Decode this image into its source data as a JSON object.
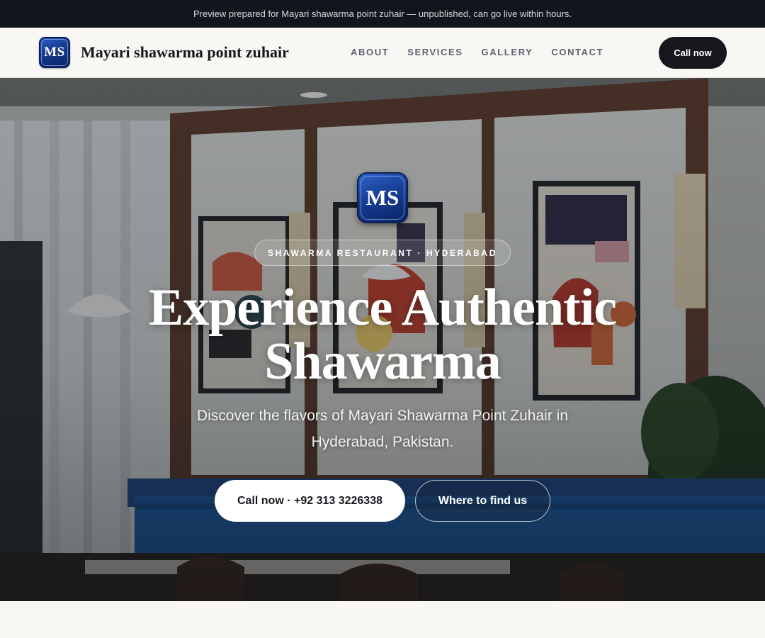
{
  "preview_banner": {
    "text": "Preview prepared for Mayari shawarma point zuhair — unpublished, can go live within hours."
  },
  "header": {
    "logo_initials": "MS",
    "brand_name": "Mayari shawarma point zuhair",
    "nav": [
      "ABOUT",
      "SERVICES",
      "GALLERY",
      "CONTACT"
    ],
    "cta_label": "Call now"
  },
  "hero": {
    "logo_initials": "MS",
    "eyebrow": "SHAWARMA RESTAURANT · HYDERABAD",
    "title_line1": "Experience Authentic",
    "title_line2": "Shawarma",
    "subtitle": "Discover the flavors of Mayari Shawarma Point Zuhair in Hyderabad, Pakistan.",
    "primary_button": "Call now · +92 313 3226338",
    "secondary_button": "Where to find us",
    "background_image": "restaurant-interior"
  },
  "colors": {
    "dark": "#12151b",
    "logo_blue": "#143a8f",
    "page_bg": "#f8f7f4"
  }
}
